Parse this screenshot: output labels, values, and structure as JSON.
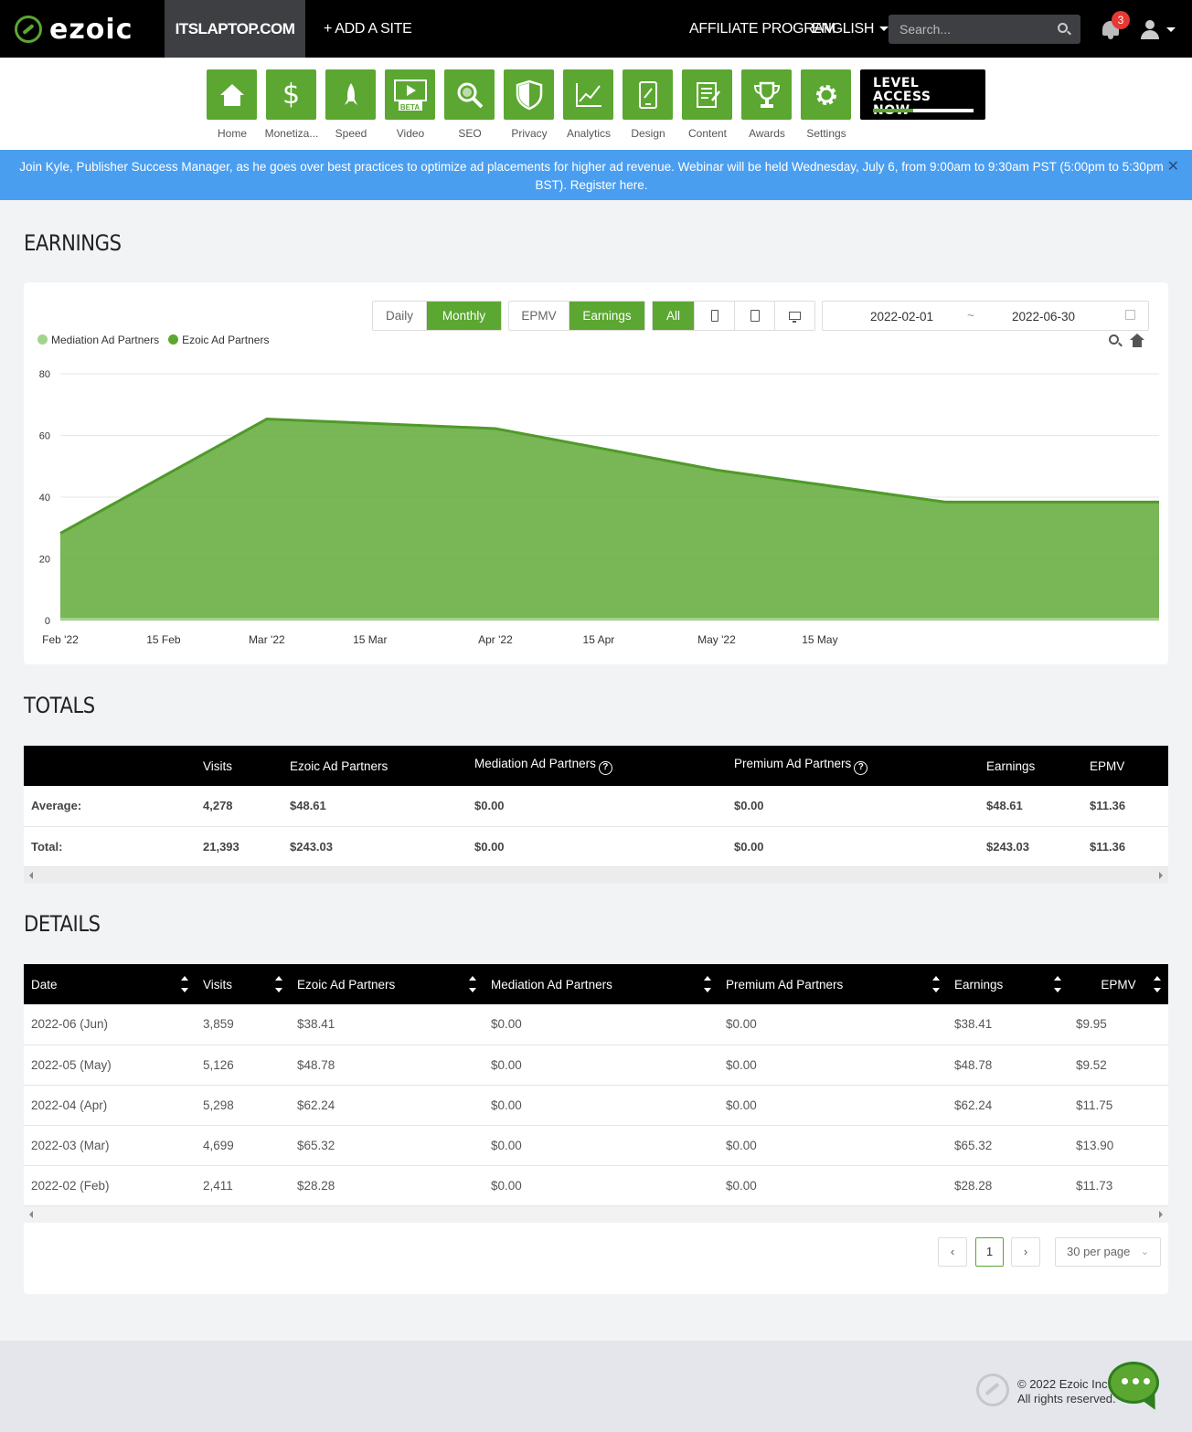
{
  "header": {
    "brand": "ezoic",
    "site": "ITSLAPTOP.COM",
    "add_site": "+ ADD A SITE",
    "affiliate": "AFFILIATE PROGRAM",
    "language": "ENGLISH",
    "search_placeholder": "Search...",
    "notifications": "3"
  },
  "nav": {
    "items": [
      {
        "label": "Home",
        "icon": "home-icon"
      },
      {
        "label": "Monetiza...",
        "icon": "dollar-icon"
      },
      {
        "label": "Speed",
        "icon": "rocket-icon"
      },
      {
        "label": "Video",
        "icon": "video-icon",
        "tag": "BETA"
      },
      {
        "label": "SEO",
        "icon": "magnifier-icon"
      },
      {
        "label": "Privacy",
        "icon": "shield-icon"
      },
      {
        "label": "Analytics",
        "icon": "line-chart-icon"
      },
      {
        "label": "Design",
        "icon": "design-icon"
      },
      {
        "label": "Content",
        "icon": "document-icon"
      },
      {
        "label": "Awards",
        "icon": "trophy-icon"
      },
      {
        "label": "Settings",
        "icon": "gear-icon"
      }
    ],
    "level_line1": "LEVEL",
    "level_line2": "ACCESS NOW",
    "level_progress": 0.4
  },
  "banner": {
    "text": "Join Kyle, Publisher Success Manager, as he goes over best practices to optimize ad placements for higher ad revenue. Webinar will be held Wednesday, July 6, from 9:00am to 9:30am PST (5:00pm to 5:30pm BST).",
    "link": "Register here."
  },
  "earnings": {
    "title": "EARNINGS",
    "period_options": [
      "Daily",
      "Monthly"
    ],
    "period_selected": "Monthly",
    "metric_options": [
      "EPMV",
      "Earnings"
    ],
    "metric_selected": "Earnings",
    "device_options": [
      "All"
    ],
    "date_from": "2022-02-01",
    "date_sep": "~",
    "date_to": "2022-06-30"
  },
  "chart_data": {
    "type": "area",
    "x": [
      "2022-02-01",
      "2022-03-01",
      "2022-04-01",
      "2022-05-01",
      "2022-06-01",
      "2022-06-30"
    ],
    "x_tick_labels": [
      "Feb '22",
      "15 Feb",
      "Mar '22",
      "15 Mar",
      "Apr '22",
      "15 Apr",
      "May '22",
      "15 May"
    ],
    "y_ticks": [
      0,
      20,
      40,
      60,
      80
    ],
    "ylim": [
      0,
      80
    ],
    "series": [
      {
        "name": "Mediation Ad Partners",
        "color": "#a3d48c",
        "values": [
          0,
          0,
          0,
          0,
          0,
          0
        ]
      },
      {
        "name": "Ezoic Ad Partners",
        "color": "#5ba731",
        "values": [
          28.28,
          65.32,
          62.24,
          48.78,
          38.41,
          38.41
        ]
      }
    ],
    "grid": true,
    "legend_position": "top-left"
  },
  "totals": {
    "title": "TOTALS",
    "columns": [
      "",
      "Visits",
      "Ezoic Ad Partners",
      "Mediation Ad Partners",
      "Premium Ad Partners",
      "Earnings",
      "EPMV"
    ],
    "rows": [
      [
        "Average:",
        "4,278",
        "$48.61",
        "$0.00",
        "$0.00",
        "$48.61",
        "$11.36"
      ],
      [
        "Total:",
        "21,393",
        "$243.03",
        "$0.00",
        "$0.00",
        "$243.03",
        "$11.36"
      ]
    ]
  },
  "details": {
    "title": "DETAILS",
    "columns": [
      "Date",
      "Visits",
      "Ezoic Ad Partners",
      "Mediation Ad Partners",
      "Premium Ad Partners",
      "Earnings",
      "EPMV"
    ],
    "rows": [
      [
        "2022-06 (Jun)",
        "3,859",
        "$38.41",
        "$0.00",
        "$0.00",
        "$38.41",
        "$9.95"
      ],
      [
        "2022-05 (May)",
        "5,126",
        "$48.78",
        "$0.00",
        "$0.00",
        "$48.78",
        "$9.52"
      ],
      [
        "2022-04 (Apr)",
        "5,298",
        "$62.24",
        "$0.00",
        "$0.00",
        "$62.24",
        "$11.75"
      ],
      [
        "2022-03 (Mar)",
        "4,699",
        "$65.32",
        "$0.00",
        "$0.00",
        "$65.32",
        "$13.90"
      ],
      [
        "2022-02 (Feb)",
        "2,411",
        "$28.28",
        "$0.00",
        "$0.00",
        "$28.28",
        "$11.73"
      ]
    ],
    "page": "1",
    "per_page": "30 per page"
  },
  "footer": {
    "line1": "© 2022 Ezoic Inc.",
    "line2": "All rights reserved."
  }
}
